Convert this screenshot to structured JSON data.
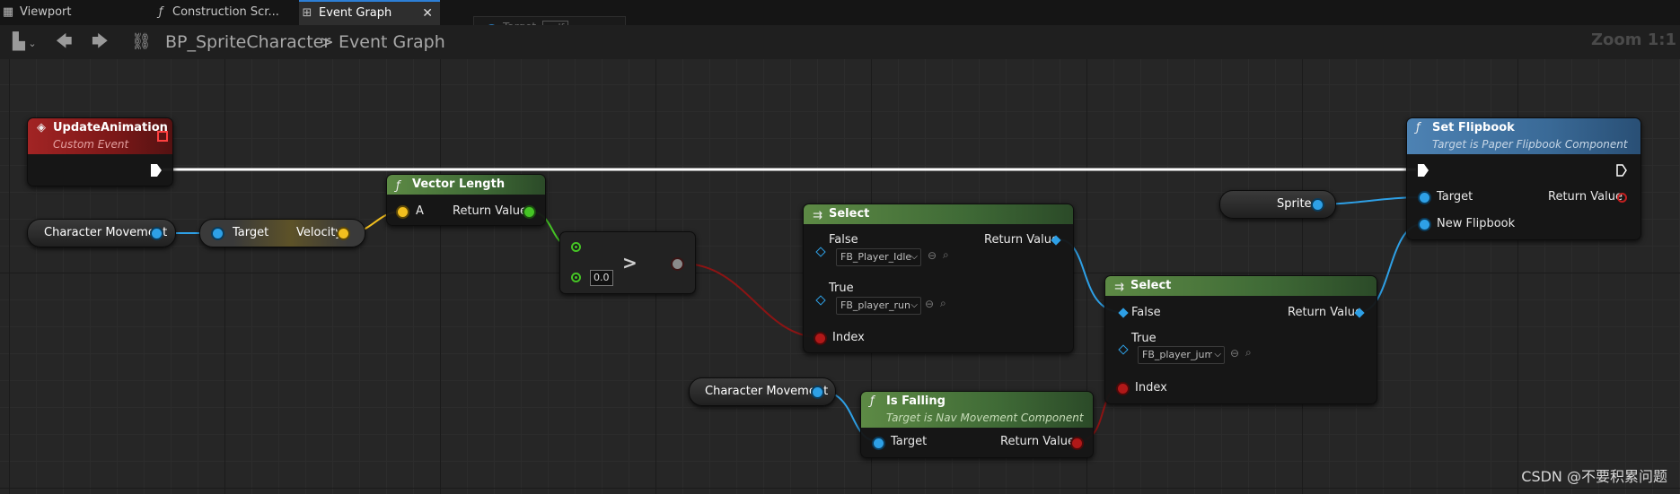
{
  "tabs": [
    {
      "icon": "viewport-icon",
      "label": "Viewport"
    },
    {
      "icon": "function-icon",
      "label": "Construction Scr..."
    },
    {
      "icon": "event-graph-icon",
      "label": "Event Graph",
      "active": true
    }
  ],
  "toolbar": {
    "blueprint_name": "BP_SpriteCharacter",
    "separator": ">",
    "graph_name": "Event Graph",
    "zoom": "Zoom 1:1"
  },
  "ghost_node": {
    "pin_label": "Target",
    "value": "self"
  },
  "nodes": {
    "update_animation": {
      "title": "UpdateAnimation",
      "subtitle": "Custom Event"
    },
    "char_movement_1": {
      "label": "Character Movement"
    },
    "velocity_getter": {
      "input": "Target",
      "output": "Velocity"
    },
    "vector_length": {
      "title": "Vector Length",
      "input": "A",
      "output": "Return Value"
    },
    "greater": {
      "operator": ">",
      "b_value": "0.0"
    },
    "select_1": {
      "title": "Select",
      "output": "Return Value",
      "false_label": "False",
      "false_value": "FB_Player_Idle",
      "true_label": "True",
      "true_value": "FB_player_run",
      "index_label": "Index"
    },
    "char_movement_2": {
      "label": "Character Movement"
    },
    "is_falling": {
      "title": "Is Falling",
      "subtitle": "Target is Nav Movement Component",
      "input": "Target",
      "output": "Return Value"
    },
    "select_2": {
      "title": "Select",
      "output": "Return Value",
      "false_label": "False",
      "true_label": "True",
      "true_value": "FB_player_jump",
      "index_label": "Index"
    },
    "sprite": {
      "label": "Sprite"
    },
    "set_flipbook": {
      "title": "Set Flipbook",
      "subtitle": "Target is Paper Flipbook Component",
      "target": "Target",
      "output": "Return Value",
      "new_flipbook": "New Flipbook"
    }
  },
  "colors": {
    "object_pin": "#2ea0e6",
    "vector_pin": "#f2bf1f",
    "float_pin": "#45c425",
    "bool_pin": "#b01818",
    "exec_wire": "#ffffff"
  },
  "watermark": "CSDN @不要积累问题"
}
